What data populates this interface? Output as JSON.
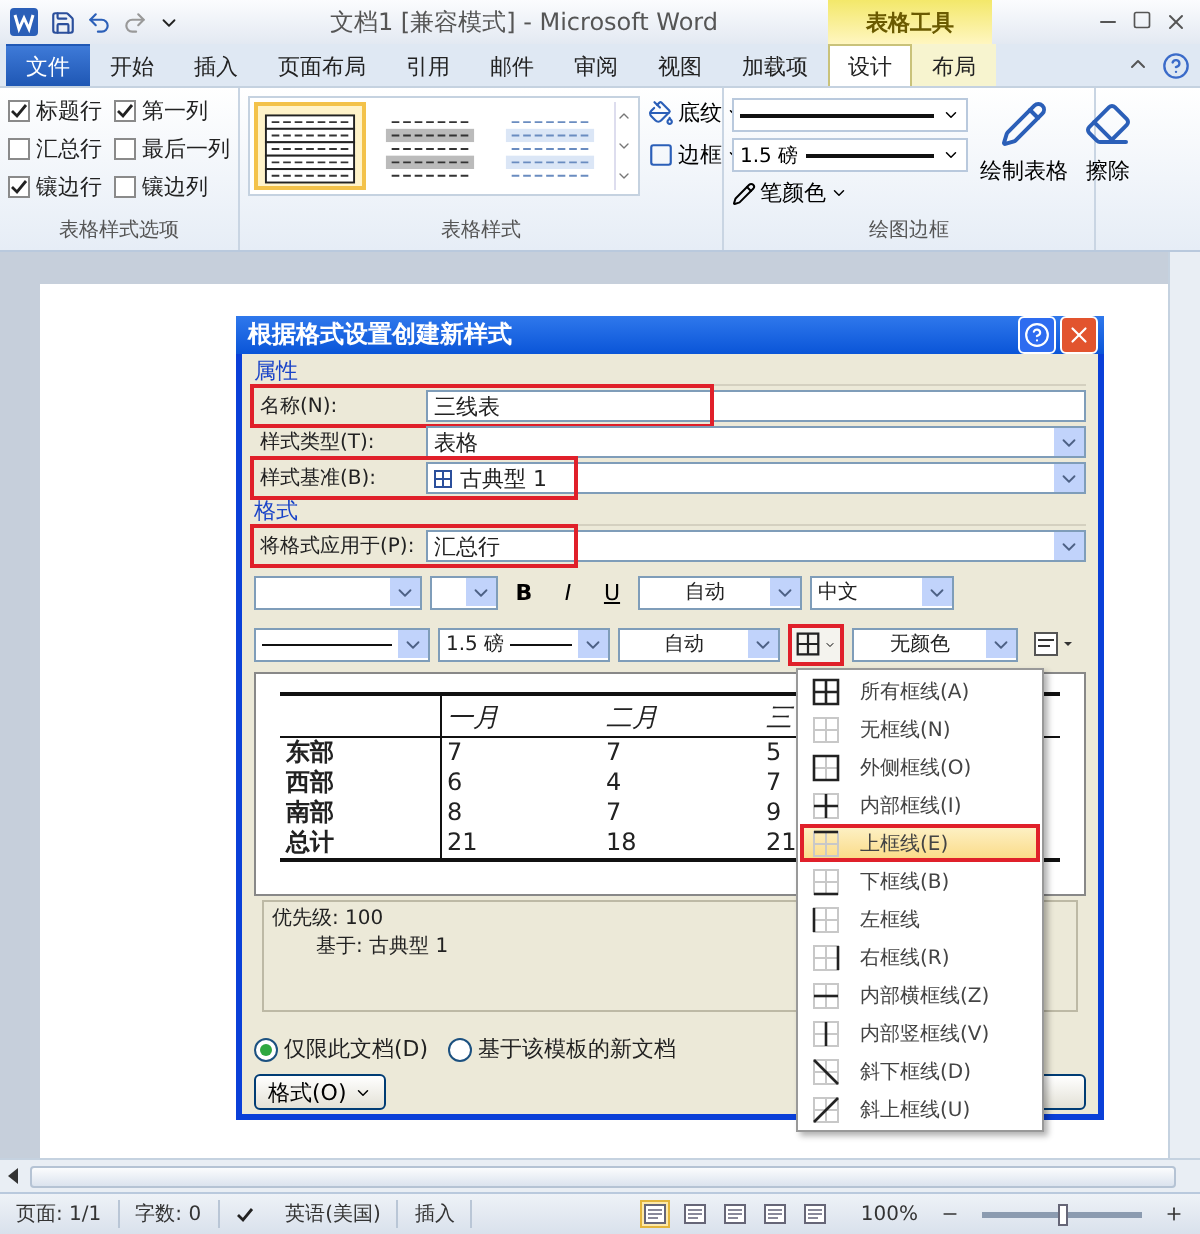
{
  "title_bar": {
    "title": "文档1 [兼容模式]  -  Microsoft Word",
    "context_tab": "表格工具"
  },
  "ribbon_tabs": [
    {
      "label": "文件",
      "kind": "file",
      "selected": false
    },
    {
      "label": "开始",
      "kind": "plain",
      "selected": false
    },
    {
      "label": "插入",
      "kind": "plain",
      "selected": false
    },
    {
      "label": "页面布局",
      "kind": "plain",
      "selected": false
    },
    {
      "label": "引用",
      "kind": "plain",
      "selected": false
    },
    {
      "label": "邮件",
      "kind": "plain",
      "selected": false
    },
    {
      "label": "审阅",
      "kind": "plain",
      "selected": false
    },
    {
      "label": "视图",
      "kind": "plain",
      "selected": false
    },
    {
      "label": "加载项",
      "kind": "plain",
      "selected": false
    },
    {
      "label": "设计",
      "kind": "context",
      "selected": true
    },
    {
      "label": "布局",
      "kind": "context",
      "selected": false
    }
  ],
  "ribbon": {
    "style_options": {
      "label": "表格样式选项",
      "checkboxes": [
        {
          "label": "标题行",
          "checked": true
        },
        {
          "label": "第一列",
          "checked": true
        },
        {
          "label": "汇总行",
          "checked": false
        },
        {
          "label": "最后一列",
          "checked": false
        },
        {
          "label": "镶边行",
          "checked": true
        },
        {
          "label": "镶边列",
          "checked": false
        }
      ]
    },
    "table_styles": {
      "label": "表格样式",
      "thumbnails": [
        {
          "kind": "grid",
          "selected": true
        },
        {
          "kind": "shaded",
          "selected": false
        },
        {
          "kind": "light",
          "selected": false
        }
      ],
      "buttons": [
        "底纹",
        "边框"
      ]
    },
    "draw_borders": {
      "label": "绘图边框",
      "weight": "1.5 磅",
      "pen_color": "笔颜色",
      "buttons": [
        "绘制表格",
        "擦除"
      ]
    }
  },
  "dialog": {
    "title": "根据格式设置创建新样式",
    "properties_label": "属性",
    "fields": [
      {
        "label": "名称(N):",
        "value": "三线表",
        "kind": "text",
        "highlighted": true
      },
      {
        "label": "样式类型(T):",
        "value": "表格",
        "kind": "dropdown",
        "highlighted": false
      },
      {
        "label": "样式基准(B):",
        "value": "古典型 1",
        "kind": "style",
        "highlighted": true
      }
    ],
    "format_label": "格式",
    "apply_to": {
      "label": "将格式应用于(P):",
      "value": "汇总行",
      "highlighted": true
    },
    "font_bar": {
      "bold": "B",
      "italic": "I",
      "underline": "U",
      "font_color_option": "自动",
      "script": "中文"
    },
    "border_bar": {
      "weight": "1.5 磅",
      "line_color_option": "自动",
      "shading": "无颜色",
      "border_highlighted": true
    },
    "preview": {
      "columns": [
        "",
        "一月",
        "二月",
        "三"
      ],
      "rows": [
        [
          "东部",
          "7",
          "7",
          "5"
        ],
        [
          "西部",
          "6",
          "4",
          "7"
        ],
        [
          "南部",
          "8",
          "7",
          "9"
        ],
        [
          "总计",
          "21",
          "18",
          "21"
        ]
      ]
    },
    "description": [
      "优先级: 100",
      "基于: 古典型 1"
    ],
    "scope": [
      {
        "label": "仅限此文档(D)",
        "selected": true
      },
      {
        "label": "基于该模板的新文档",
        "selected": false
      }
    ],
    "format_button": "格式(O)",
    "border_menu": [
      {
        "label": "所有框线(A)",
        "kind": "all",
        "selected": false
      },
      {
        "label": "无框线(N)",
        "kind": "none",
        "selected": false
      },
      {
        "label": "外侧框线(O)",
        "kind": "outside",
        "selected": false
      },
      {
        "label": "内部框线(I)",
        "kind": "inside",
        "selected": false
      },
      {
        "label": "上框线(E)",
        "kind": "top",
        "selected": true
      },
      {
        "label": "下框线(B)",
        "kind": "bottom",
        "selected": false
      },
      {
        "label": "左框线",
        "kind": "left",
        "selected": false
      },
      {
        "label": "右框线(R)",
        "kind": "right",
        "selected": false
      },
      {
        "label": "内部横框线(Z)",
        "kind": "inside-h",
        "selected": false
      },
      {
        "label": "内部竖框线(V)",
        "kind": "inside-v",
        "selected": false
      },
      {
        "label": "斜下框线(D)",
        "kind": "diag-down",
        "selected": false
      },
      {
        "label": "斜上框线(U)",
        "kind": "diag-up",
        "selected": false
      }
    ]
  },
  "status_bar": {
    "page": "页面: 1/1",
    "words": "字数: 0",
    "language": "英语(美国)",
    "mode": "插入",
    "zoom": "100%",
    "zoom_slider": {
      "level": 0.5
    }
  }
}
